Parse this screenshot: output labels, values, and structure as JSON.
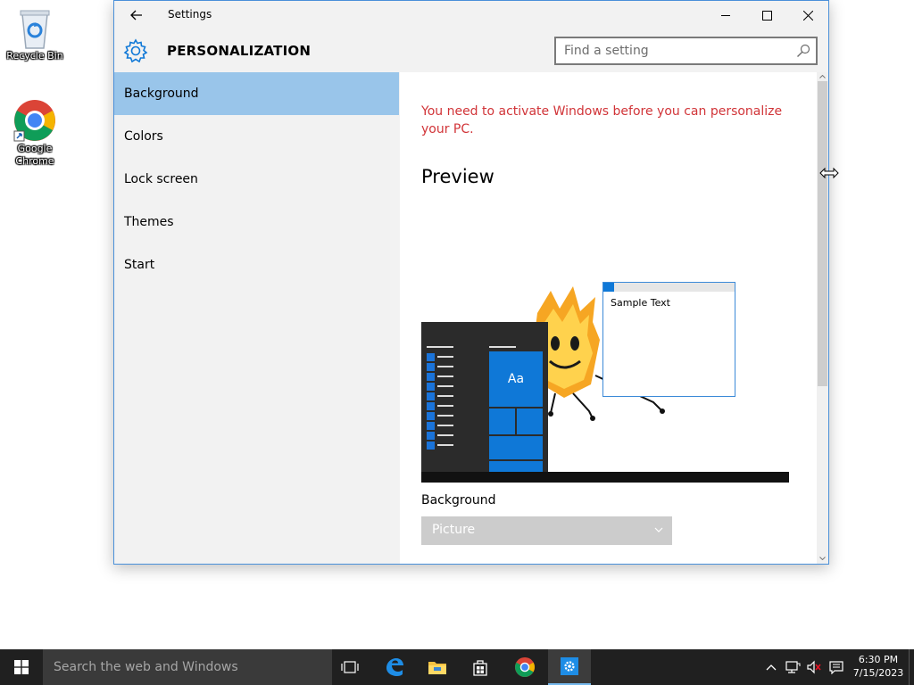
{
  "desktop": {
    "icons": [
      {
        "label": "Recycle Bin",
        "icon": "recycle-bin-icon"
      },
      {
        "label": "Google Chrome",
        "icon": "chrome-icon"
      }
    ]
  },
  "window": {
    "title": "Settings",
    "heading": "PERSONALIZATION",
    "search_placeholder": "Find a setting",
    "controls": {
      "minimize": "minimize-icon",
      "maximize": "maximize-icon",
      "close": "close-icon"
    }
  },
  "sidebar": {
    "items": [
      {
        "label": "Background",
        "active": true
      },
      {
        "label": "Colors",
        "active": false
      },
      {
        "label": "Lock screen",
        "active": false
      },
      {
        "label": "Themes",
        "active": false
      },
      {
        "label": "Start",
        "active": false
      }
    ]
  },
  "content": {
    "activation_message": "You need to activate Windows before you can personalize your PC.",
    "preview_title": "Preview",
    "preview": {
      "tile_label": "Aa",
      "sample_text": "Sample Text"
    },
    "background_label": "Background",
    "background_value": "Picture"
  },
  "taskbar": {
    "search_placeholder": "Search the web and Windows",
    "apps": [
      "task-view-icon",
      "edge-icon",
      "file-explorer-icon",
      "store-icon",
      "chrome-icon",
      "settings-icon"
    ],
    "active_app": "settings-icon",
    "time": "6:30 PM",
    "date": "7/15/2023"
  },
  "colors": {
    "accent": "#0f78d7",
    "selected_item": "#99c5ea",
    "warning_text": "#d13438",
    "taskbar": "#202020"
  }
}
